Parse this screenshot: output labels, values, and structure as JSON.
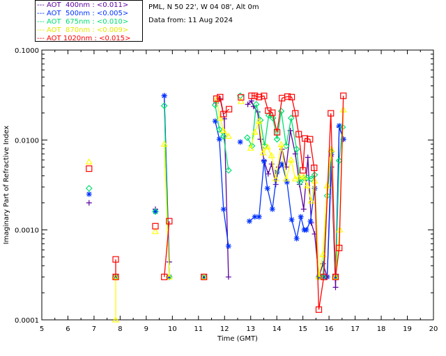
{
  "header": {
    "site": "PML, N 50 22', W 04 08', Alt 0m",
    "date": "Data from: 11 Aug 2024"
  },
  "legend": [
    {
      "text": "--- AOT  400nm : <0.011>",
      "color": "#5a00a0"
    },
    {
      "text": "--- AOT  500nm : <0.005>",
      "color": "#0033ff"
    },
    {
      "text": "--- AOT  675nm : <0.010>",
      "color": "#00e070"
    },
    {
      "text": "--- AOT  870nm : <0.009>",
      "color": "#ffff00"
    },
    {
      "text": "--- AOT 1020nm : <0.015>",
      "color": "#ff0000"
    }
  ],
  "chart_data": {
    "type": "line",
    "xlabel": "Time (GMT)",
    "ylabel": "Imaginary Part of Refractive Index",
    "xlim": [
      5,
      20
    ],
    "ylim": [
      0.0001,
      0.1
    ],
    "yscale": "log",
    "xticks": [
      "5",
      "6",
      "7",
      "8",
      "9",
      "10",
      "11",
      "12",
      "13",
      "14",
      "15",
      "16",
      "17",
      "18",
      "19",
      "20"
    ],
    "yticks": [
      "0.0001",
      "0.0010",
      "0.0100",
      "0.1000"
    ],
    "grid": false,
    "legend_position": "top-left outside",
    "series": [
      {
        "name": "AOT 400nm",
        "color": "#5a00a0",
        "marker": "plus",
        "points": [
          [
            6.81,
            0.002
          ],
          null,
          [
            7.83,
            0.0003
          ],
          null,
          [
            9.35,
            0.0017
          ],
          null,
          [
            9.69,
            0.031
          ],
          [
            9.88,
            0.00044
          ],
          null,
          [
            11.21,
            0.0003
          ],
          null,
          [
            11.67,
            0.0258
          ],
          [
            11.83,
            0.0288
          ],
          [
            11.99,
            0.0172
          ],
          [
            12.15,
            0.0003
          ],
          null,
          [
            12.89,
            0.0249
          ],
          [
            13.03,
            0.0272
          ],
          [
            13.11,
            0.0236
          ],
          [
            13.27,
            0.0205
          ],
          [
            13.37,
            0.0102
          ],
          [
            13.51,
            0.0059
          ],
          [
            13.67,
            0.0042
          ],
          [
            13.8,
            0.0054
          ],
          [
            13.96,
            0.0032
          ],
          [
            14.07,
            0.005
          ],
          [
            14.2,
            0.0079
          ],
          [
            14.36,
            0.005
          ],
          [
            14.52,
            0.0127
          ],
          [
            14.71,
            0.007
          ],
          [
            14.87,
            0.0032
          ],
          [
            15.03,
            0.0017
          ],
          [
            15.19,
            0.0064
          ],
          [
            15.32,
            0.0012
          ],
          [
            15.45,
            0.0009
          ],
          [
            15.61,
            0.0003
          ],
          [
            15.77,
            0.00042
          ],
          [
            15.93,
            0.0003
          ],
          [
            16.09,
            0.005
          ],
          [
            16.25,
            0.00023
          ],
          [
            16.39,
            0.0139
          ],
          [
            16.55,
            0.0102
          ]
        ]
      },
      {
        "name": "AOT 500nm",
        "color": "#0033ff",
        "marker": "asterisk",
        "points": [
          [
            6.81,
            0.0025
          ],
          null,
          [
            7.83,
            0.0003
          ],
          null,
          [
            9.35,
            0.0016
          ],
          null,
          [
            9.69,
            0.031
          ],
          [
            9.88,
            0.0003
          ],
          null,
          [
            11.21,
            0.0003
          ],
          null,
          [
            11.64,
            0.0162
          ],
          [
            11.8,
            0.0102
          ],
          [
            11.96,
            0.0017
          ],
          [
            12.15,
            0.00066
          ],
          null,
          [
            12.6,
            0.0095
          ],
          null,
          [
            12.95,
            0.00125
          ],
          [
            13.16,
            0.0014
          ],
          [
            13.32,
            0.0014
          ],
          [
            13.51,
            0.0058
          ],
          [
            13.64,
            0.0029
          ],
          [
            13.83,
            0.0017
          ],
          [
            14.01,
            0.0044
          ],
          [
            14.2,
            0.0054
          ],
          [
            14.39,
            0.0034
          ],
          [
            14.57,
            0.0013
          ],
          [
            14.76,
            0.0008
          ],
          [
            14.92,
            0.0014
          ],
          [
            15.05,
            0.001
          ],
          [
            15.13,
            0.001
          ],
          [
            15.29,
            0.00125
          ],
          [
            15.45,
            0.0029
          ],
          [
            15.61,
            0.0003
          ],
          [
            15.8,
            0.0003
          ],
          [
            15.93,
            0.0003
          ],
          [
            16.09,
            0.0069
          ],
          [
            16.25,
            0.0003
          ],
          [
            16.39,
            0.0144
          ],
          [
            16.55,
            0.0102
          ]
        ]
      },
      {
        "name": "AOT 675nm",
        "color": "#00e070",
        "marker": "diamond",
        "points": [
          [
            6.81,
            0.0029
          ],
          null,
          [
            7.83,
            0.0003
          ],
          null,
          [
            9.35,
            0.0016
          ],
          null,
          [
            9.69,
            0.024
          ],
          [
            9.88,
            0.0003
          ],
          null,
          [
            11.21,
            0.0003
          ],
          null,
          [
            11.64,
            0.0245
          ],
          [
            11.8,
            0.0131
          ],
          [
            11.96,
            0.011
          ],
          [
            12.15,
            0.0046
          ],
          null,
          [
            12.6,
            0.031
          ],
          null,
          [
            12.87,
            0.0106
          ],
          [
            13.05,
            0.0086
          ],
          [
            13.21,
            0.0249
          ],
          [
            13.37,
            0.0166
          ],
          [
            13.53,
            0.0086
          ],
          [
            13.69,
            0.0188
          ],
          [
            13.85,
            0.0175
          ],
          [
            14.01,
            0.0102
          ],
          [
            14.17,
            0.0209
          ],
          [
            14.36,
            0.0086
          ],
          [
            14.55,
            0.0175
          ],
          [
            14.76,
            0.0079
          ],
          [
            14.89,
            0.0034
          ],
          [
            15.03,
            0.0038
          ],
          [
            15.16,
            0.0038
          ],
          [
            15.32,
            0.0037
          ],
          [
            15.45,
            0.0041
          ],
          [
            15.61,
            0.0003
          ],
          [
            15.77,
            0.0003
          ],
          [
            15.93,
            0.0024
          ],
          [
            16.09,
            0.0074
          ],
          [
            16.25,
            0.0003
          ],
          [
            16.39,
            0.0059
          ],
          [
            16.52,
            0.0139
          ]
        ]
      },
      {
        "name": "AOT 870nm",
        "color": "#ffff00",
        "marker": "triangle",
        "points": [
          [
            6.81,
            0.0057
          ],
          null,
          [
            7.83,
            0.0003
          ],
          [
            7.83,
            0.0001
          ],
          null,
          [
            9.35,
            0.00096
          ],
          null,
          [
            9.69,
            0.009
          ],
          [
            9.88,
            0.0003
          ],
          null,
          [
            11.21,
            0.0003
          ],
          null,
          [
            11.69,
            0.0282
          ],
          [
            11.83,
            0.0175
          ],
          [
            11.96,
            0.0127
          ],
          [
            12.15,
            0.011
          ],
          null,
          [
            12.63,
            0.0268
          ],
          null,
          [
            13.0,
            0.0081
          ],
          [
            13.16,
            0.0122
          ],
          [
            13.32,
            0.0162
          ],
          [
            13.48,
            0.0072
          ],
          [
            13.64,
            0.0084
          ],
          [
            13.8,
            0.0067
          ],
          [
            13.96,
            0.0037
          ],
          [
            14.17,
            0.0089
          ],
          [
            14.36,
            0.0037
          ],
          [
            14.55,
            0.006
          ],
          [
            14.71,
            0.0037
          ],
          [
            14.87,
            0.0039
          ],
          [
            15.03,
            0.0039
          ],
          [
            15.16,
            0.0031
          ],
          [
            15.32,
            0.0021
          ],
          [
            15.45,
            0.0035
          ],
          [
            15.61,
            0.0003
          ],
          [
            15.77,
            0.00053
          ],
          [
            15.93,
            0.0031
          ],
          [
            16.09,
            0.0079
          ],
          [
            16.25,
            0.0003
          ],
          [
            16.41,
            0.001
          ],
          [
            16.55,
            0.0216
          ]
        ]
      },
      {
        "name": "AOT 1020nm",
        "color": "#ff0000",
        "marker": "square",
        "points": [
          [
            6.81,
            0.0048
          ],
          null,
          [
            7.83,
            0.00047
          ],
          [
            7.83,
            0.0003
          ],
          null,
          [
            9.35,
            0.0011
          ],
          null,
          [
            9.69,
            0.0003
          ],
          [
            9.88,
            0.00125
          ],
          null,
          [
            11.21,
            0.0003
          ],
          null,
          [
            11.69,
            0.0288
          ],
          [
            11.83,
            0.03
          ],
          [
            11.96,
            0.0194
          ],
          [
            12.17,
            0.022
          ],
          null,
          [
            12.63,
            0.0298
          ],
          null,
          [
            13.03,
            0.031
          ],
          [
            13.16,
            0.031
          ],
          [
            13.32,
            0.03
          ],
          [
            13.51,
            0.0309
          ],
          [
            13.67,
            0.0212
          ],
          [
            13.83,
            0.0201
          ],
          [
            14.01,
            0.0122
          ],
          [
            14.2,
            0.0292
          ],
          [
            14.41,
            0.0304
          ],
          [
            14.57,
            0.03
          ],
          [
            14.71,
            0.0198
          ],
          [
            14.84,
            0.0116
          ],
          [
            15.0,
            0.0046
          ],
          [
            15.08,
            0.0104
          ],
          [
            15.27,
            0.0102
          ],
          [
            15.43,
            0.0049
          ],
          [
            15.61,
            0.00013
          ],
          [
            15.8,
            0.0003
          ],
          [
            16.07,
            0.0198
          ],
          [
            16.25,
            0.0003
          ],
          [
            16.39,
            0.00063
          ],
          [
            16.55,
            0.031
          ]
        ]
      }
    ]
  }
}
